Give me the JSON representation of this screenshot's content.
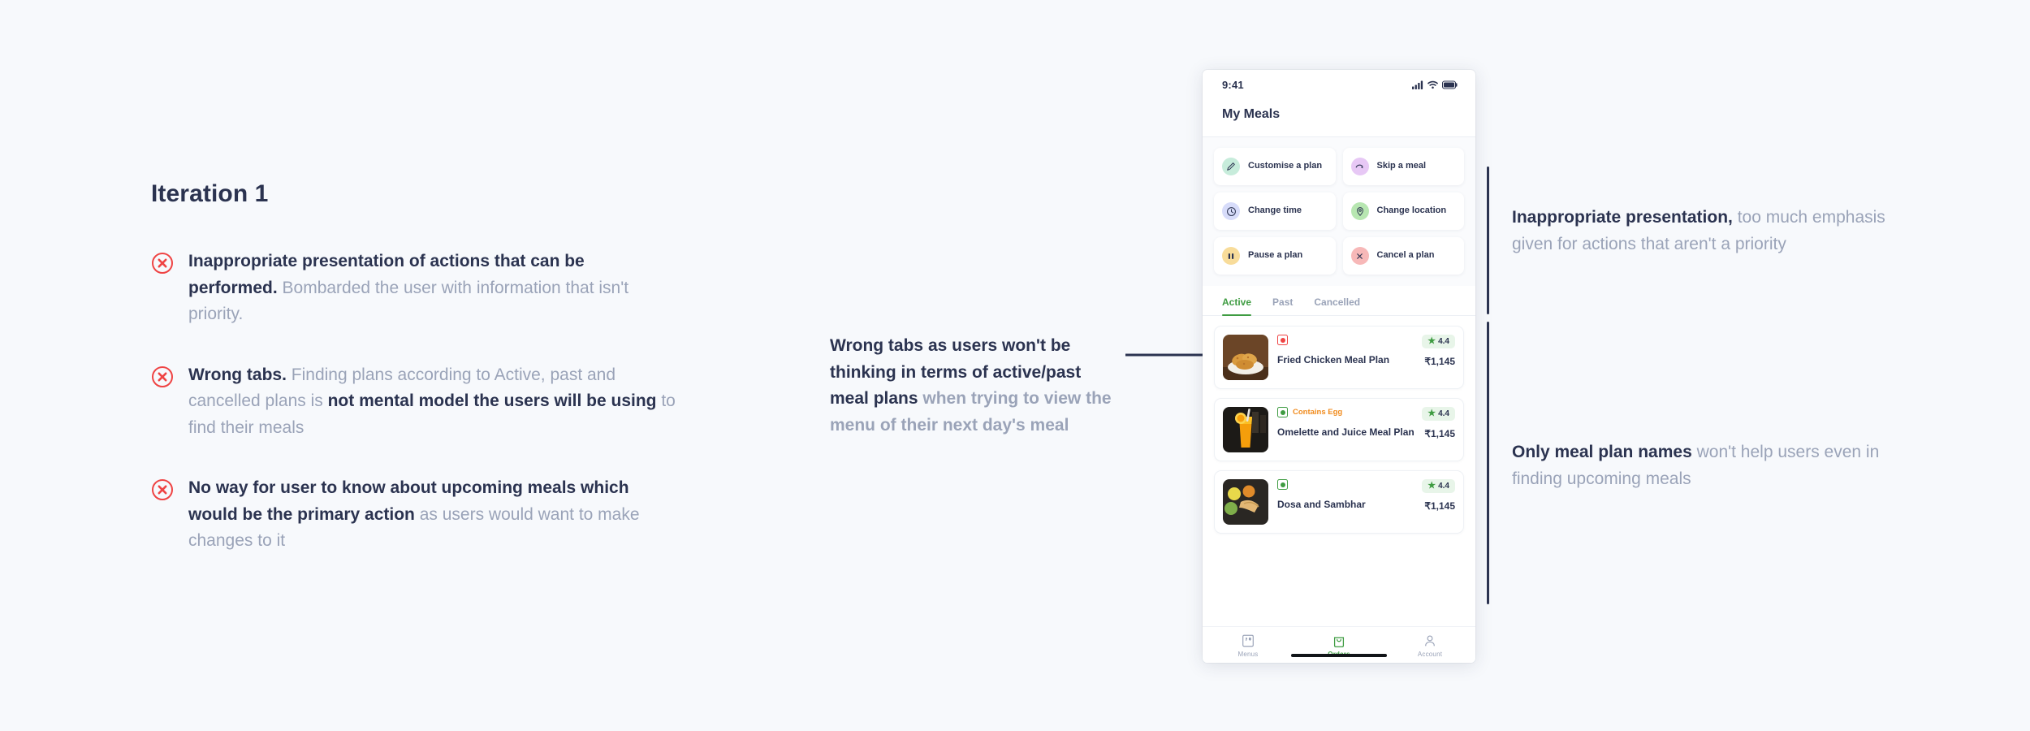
{
  "colors": {
    "page_bg": "#f7f9fc",
    "ink": "#2b3350",
    "muted": "#9aa3b8",
    "accent_green": "#3f9c42",
    "error_red": "#ef4444",
    "egg_orange": "#f08b1d"
  },
  "left": {
    "title": "Iteration 1",
    "issues": [
      {
        "icon": "error-circle-icon",
        "bold": "Inappropriate presentation of actions that can be performed.",
        "rest": " Bombarded the user with information that isn't priority."
      },
      {
        "icon": "error-circle-icon",
        "bold": "Wrong tabs.",
        "mid": " Finding plans according to Active, past and cancelled plans is ",
        "bold2": "not mental model the users will be using",
        "rest": " to find their meals"
      },
      {
        "icon": "error-circle-icon",
        "bold": "No way for user to know about upcoming meals which would be the primary action",
        "rest": " as users would want to make changes to it"
      }
    ]
  },
  "middle_annotation": {
    "bold": "Wrong tabs as users won't be thinking in terms of active/past meal plans",
    "rest": " when trying to view the menu of their next day's meal"
  },
  "right_annotations": [
    {
      "bold": "Inappropriate presentation,",
      "rest": " too much emphasis given for actions that aren't a priority"
    },
    {
      "bold": "Only meal plan names",
      "rest": " won't help users even in finding upcoming meals"
    }
  ],
  "phone": {
    "status": {
      "time": "9:41",
      "icons": [
        "signal-icon",
        "wifi-icon",
        "battery-icon"
      ]
    },
    "title": "My Meals",
    "actions": [
      {
        "label": "Customise a plan",
        "icon": "pencil-icon",
        "bg": "#c7ecdb",
        "fg": "#2b3350"
      },
      {
        "label": "Skip a meal",
        "icon": "skip-arrow-icon",
        "bg": "#e7c8f5",
        "fg": "#2b3350"
      },
      {
        "label": "Change time",
        "icon": "clock-icon",
        "bg": "#d7dcfa",
        "fg": "#2b3350"
      },
      {
        "label": "Change location",
        "icon": "location-pin-icon",
        "bg": "#b7e6b1",
        "fg": "#2b3350"
      },
      {
        "label": "Pause a plan",
        "icon": "pause-icon",
        "bg": "#f8dc9a",
        "fg": "#2b3350"
      },
      {
        "label": "Cancel a plan",
        "icon": "close-x-icon",
        "bg": "#f7b8b8",
        "fg": "#2b3350"
      }
    ],
    "tabs": [
      {
        "label": "Active",
        "active": true
      },
      {
        "label": "Past",
        "active": false
      },
      {
        "label": "Cancelled",
        "active": false
      }
    ],
    "meals": [
      {
        "name": "Fried Chicken Meal Plan",
        "price": "₹1,145",
        "rating": "4.4",
        "diet": "nonveg",
        "diet_label": "",
        "thumb": "fried-chicken-thumbnail"
      },
      {
        "name": "Omelette and Juice Meal Plan",
        "price": "₹1,145",
        "rating": "4.4",
        "diet": "veg",
        "diet_label": "Contains Egg",
        "thumb": "juice-glass-thumbnail"
      },
      {
        "name": "Dosa and Sambhar",
        "price": "₹1,145",
        "rating": "4.4",
        "diet": "veg",
        "diet_label": "",
        "thumb": "dosa-platter-thumbnail"
      }
    ],
    "bottom_nav": [
      {
        "label": "Menus",
        "icon": "menu-book-icon",
        "active": false
      },
      {
        "label": "Orders",
        "icon": "shopping-bag-icon",
        "active": true
      },
      {
        "label": "Account",
        "icon": "person-icon",
        "active": false
      }
    ]
  }
}
